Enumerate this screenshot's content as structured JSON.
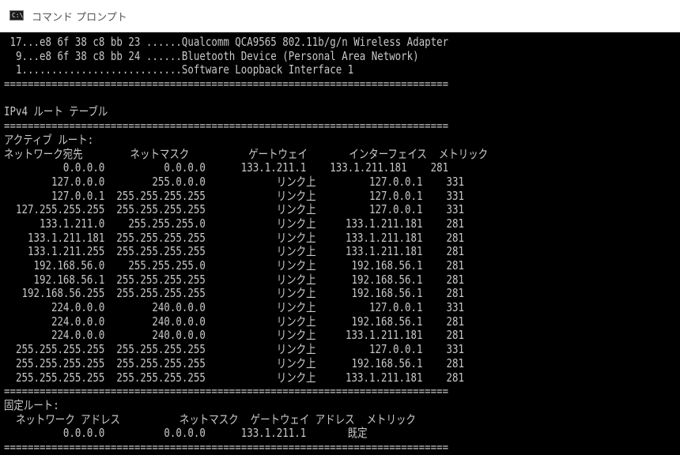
{
  "window": {
    "title": "コマンド プロンプト",
    "icon_text": "C:\\"
  },
  "console": {
    "lines": [
      " 17...e8 6f 38 c8 bb 23 ......Qualcomm QCA9565 802.11b/g/n Wireless Adapter",
      "  9...e8 6f 38 c8 bb 24 ......Bluetooth Device (Personal Area Network)",
      "  1...........................Software Loopback Interface 1",
      "===========================================================================",
      "",
      "IPv4 ルート テーブル",
      "===========================================================================",
      "アクティブ ルート:",
      "ネットワーク宛先        ネットマスク          ゲートウェイ       インターフェイス  メトリック",
      "          0.0.0.0          0.0.0.0      133.1.211.1    133.1.211.181    281",
      "        127.0.0.0        255.0.0.0            リンク上         127.0.0.1    331",
      "        127.0.0.1  255.255.255.255            リンク上         127.0.0.1    331",
      "  127.255.255.255  255.255.255.255            リンク上         127.0.0.1    331",
      "      133.1.211.0    255.255.255.0            リンク上     133.1.211.181    281",
      "    133.1.211.181  255.255.255.255            リンク上     133.1.211.181    281",
      "    133.1.211.255  255.255.255.255            リンク上     133.1.211.181    281",
      "     192.168.56.0    255.255.255.0            リンク上      192.168.56.1    281",
      "     192.168.56.1  255.255.255.255            リンク上      192.168.56.1    281",
      "   192.168.56.255  255.255.255.255            リンク上      192.168.56.1    281",
      "        224.0.0.0        240.0.0.0            リンク上         127.0.0.1    331",
      "        224.0.0.0        240.0.0.0            リンク上      192.168.56.1    281",
      "        224.0.0.0        240.0.0.0            リンク上     133.1.211.181    281",
      "  255.255.255.255  255.255.255.255            リンク上         127.0.0.1    331",
      "  255.255.255.255  255.255.255.255            リンク上      192.168.56.1    281",
      "  255.255.255.255  255.255.255.255            リンク上     133.1.211.181    281",
      "===========================================================================",
      "固定ルート:",
      "  ネットワーク アドレス          ネットマスク  ゲートウェイ アドレス  メトリック",
      "          0.0.0.0          0.0.0.0      133.1.211.1       既定",
      "==========================================================================="
    ]
  }
}
